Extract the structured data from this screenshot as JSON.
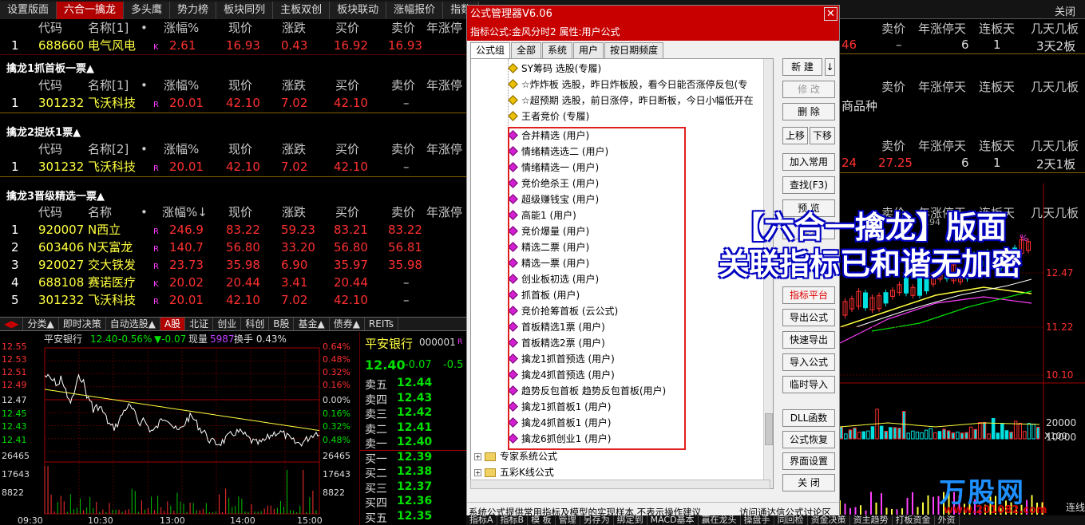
{
  "top_tabs": [
    "设置版面",
    "六合一擒龙",
    "多头鹰",
    "势力榜",
    "板块同列",
    "主板双创",
    "板块联动",
    "涨幅报价",
    "指数"
  ],
  "top_active": 1,
  "close_label": "关闭",
  "header_cols": [
    "代码",
    "名称[1]",
    "涨幅%",
    "现价",
    "涨跌",
    "买价",
    "卖价",
    "年涨停"
  ],
  "header_cols_2": [
    "代码",
    "名称[2]",
    "涨幅%",
    "现价",
    "涨跌",
    "买价",
    "卖价",
    "年涨停"
  ],
  "header_cols_3": [
    "代码",
    "名称",
    "•",
    "涨幅%↓",
    "现价",
    "涨跌",
    "买价",
    "卖价",
    "年涨停"
  ],
  "dot": "•",
  "table1": [
    {
      "idx": "1",
      "code": "688660",
      "name": "电气风电",
      "tag": "K",
      "pct": "2.61",
      "price": "16.93",
      "chg": "0.43",
      "bid": "16.92",
      "ask": "16.93"
    }
  ],
  "section2_title": "擒龙1抓首板一票▲",
  "table2": [
    {
      "idx": "1",
      "code": "301232",
      "name": "飞沃科技",
      "tag": "R",
      "pct": "20.01",
      "price": "42.10",
      "chg": "7.02",
      "bid": "42.10",
      "ask": "–"
    }
  ],
  "section3_title": "擒龙2捉妖1票▲",
  "table3": [
    {
      "idx": "1",
      "code": "301232",
      "name": "飞沃科技",
      "tag": "R",
      "pct": "20.01",
      "price": "42.10",
      "chg": "7.02",
      "bid": "42.10",
      "ask": "–"
    }
  ],
  "section4_title": "擒龙3晋级精选一票▲",
  "table4": [
    {
      "idx": "1",
      "code": "920007",
      "name": "N西立",
      "tag": "R",
      "pct": "246.9",
      "price": "83.22",
      "chg": "59.23",
      "bid": "83.21",
      "ask": "83.22"
    },
    {
      "idx": "2",
      "code": "603406",
      "name": "N天富龙",
      "tag": "R",
      "pct": "140.7",
      "price": "56.80",
      "chg": "33.20",
      "bid": "56.80",
      "ask": "56.81"
    },
    {
      "idx": "3",
      "code": "920027",
      "name": "交大铁发",
      "tag": "R",
      "pct": "23.73",
      "price": "35.98",
      "chg": "6.90",
      "bid": "35.97",
      "ask": "35.98"
    },
    {
      "idx": "4",
      "code": "688108",
      "name": "赛诺医疗",
      "tag": "K",
      "pct": "20.02",
      "price": "20.44",
      "chg": "3.41",
      "bid": "20.44",
      "ask": "–"
    },
    {
      "idx": "5",
      "code": "301232",
      "name": "飞沃科技",
      "tag": "R",
      "pct": "20.01",
      "price": "42.10",
      "chg": "7.02",
      "bid": "42.10",
      "ask": "–"
    }
  ],
  "mid_tabs": [
    "分类▲",
    "即时决策",
    "自动选股▲",
    "A股",
    "北证",
    "创业",
    "科创",
    "B股",
    "基金▲",
    "债券▲",
    "REITs"
  ],
  "mid_active": 3,
  "intraday": {
    "title": "平安银行",
    "price": "12.40",
    "pct": "-0.56%",
    "chg": "▼-0.07",
    "vol_label": "现量",
    "vol": "5987",
    "turnover": "换手 0.43%",
    "price_ticks": [
      "12.55",
      "12.53",
      "12.51",
      "12.49",
      "12.47",
      "12.45",
      "12.43",
      "12.41",
      "26465",
      "17643",
      "8822"
    ],
    "pct_ticks": [
      "0.64%",
      "0.48%",
      "0.32%",
      "0.16%",
      "0.00%",
      "0.16%",
      "0.32%",
      "0.48%",
      "26465",
      "17643",
      "8822"
    ],
    "time_ticks": [
      "09:30",
      "10:30",
      "13:00",
      "14:00",
      "15:00"
    ]
  },
  "quote": {
    "name": "平安银行",
    "code": "000001",
    "tag": "R",
    "price": "12.40",
    "chg": "-0.07",
    "pct": "-0.5",
    "levels": [
      {
        "label": "卖五",
        "price": "12.44"
      },
      {
        "label": "卖四",
        "price": "12.43"
      },
      {
        "label": "卖三",
        "price": "12.42"
      },
      {
        "label": "卖二",
        "price": "12.41"
      },
      {
        "label": "卖一",
        "price": "12.40"
      },
      {
        "label": "买一",
        "price": "12.39"
      },
      {
        "label": "买二",
        "price": "12.38"
      },
      {
        "label": "买三",
        "price": "12.37"
      },
      {
        "label": "买四",
        "price": "12.36"
      },
      {
        "label": "买五",
        "price": "12.35"
      }
    ]
  },
  "right_panel": {
    "hdr1": [
      "卖价",
      "年涨停天",
      "连板天",
      "几天几板"
    ],
    "row1": [
      "46",
      "–",
      "6",
      "1",
      "3天2板"
    ],
    "hdr2": [
      "卖价",
      "年涨停天",
      "连板天",
      "几天几板"
    ],
    "note2": "商品种",
    "hdr3": [
      "卖价",
      "年涨停天",
      "连板天",
      "几天几板"
    ],
    "row3": [
      "24",
      "27.25",
      "6",
      "1",
      "2天1板"
    ],
    "hdr4": [
      "年涨停天",
      "连板天",
      "几天几板"
    ],
    "hdr4_lead": "卖价",
    "price_ticks": [
      "12.47",
      "11.22",
      "10.10"
    ],
    "vol_ticks": [
      "20000",
      "10000",
      "X100"
    ],
    "frag_a": "194",
    "frag_b": "%",
    "frag_c": "连线"
  },
  "dialog": {
    "title": "公式管理器V6.06",
    "subtitle": "指标公式:金风分时2  属性:用户公式",
    "close": "✕",
    "tabs": [
      "公式组",
      "全部",
      "系统",
      "用户",
      "按日期频度"
    ],
    "active_tab": 0,
    "tree_top": [
      "SY筹码  选股(专履)",
      "☆炸炸板  选股，昨日炸板股，看今日能否涨停反包(专",
      "☆超预期  选股，前日涨停，昨日断板，今日小幅低开在",
      "王者竞价  (专履)"
    ],
    "tree_user": [
      "合并精选  (用户)",
      "情绪精选选二  (用户)",
      "情绪精选一  (用户)",
      "竞价绝杀王  (用户)",
      "超级赚钱宝  (用户)",
      "高能1  (用户)",
      "竞价爆量  (用户)",
      "精选二票  (用户)",
      "精选一票  (用户)",
      "创业板初选  (用户)",
      "抓首板  (用户)",
      "竞价抢筹首板  (云公式)",
      "首板精选1票  (用户)",
      "首板精选2票  (用户)",
      "擒龙1抓首预选  (用户)",
      "擒龙4抓首预选  (用户)",
      "趋势反包首板  趋势反包首板(用户)",
      "擒龙1抓首板1  (用户)",
      "擒龙4抓首板1  (用户)",
      "擒龙6抓创业1  (用户)"
    ],
    "folders": [
      "专家系统公式",
      "五彩K线公式"
    ],
    "plus": "+",
    "buttons_top": {
      "new": "新 建",
      "new_arrow": "↓",
      "modify": "修 改",
      "delete": "删 除",
      "up": "上移",
      "down": "下移"
    },
    "buttons": [
      "加入常用",
      "查找(F3)",
      "预 览"
    ],
    "overlap_frag": "说明",
    "buttons_mid": [
      "指标平台",
      "导出公式",
      "快速导出",
      "导入公式",
      "临时导入"
    ],
    "buttons_low": [
      "DLL函数",
      "公式恢复",
      "界面设置",
      "关 闭"
    ],
    "status_left": "系统公式提供常用指标及模型的实现样本,不表示操作建议",
    "status_right": "访问通达信公式讨论区"
  },
  "overlay": {
    "line1": "【六合一擒龙】版面",
    "line2": "关联指标已和谐无加密"
  },
  "watermark": {
    "logo": "万股网",
    "site": "www.201082.com"
  },
  "bottom_tabs": [
    "指标A",
    "指标B",
    "模 板",
    "管理",
    "另存为",
    "绑定到",
    "MACD基本",
    "赢在龙头",
    "操盘手",
    "同回检",
    "资金决策",
    "资主趋势",
    "打板资金",
    "外资"
  ]
}
